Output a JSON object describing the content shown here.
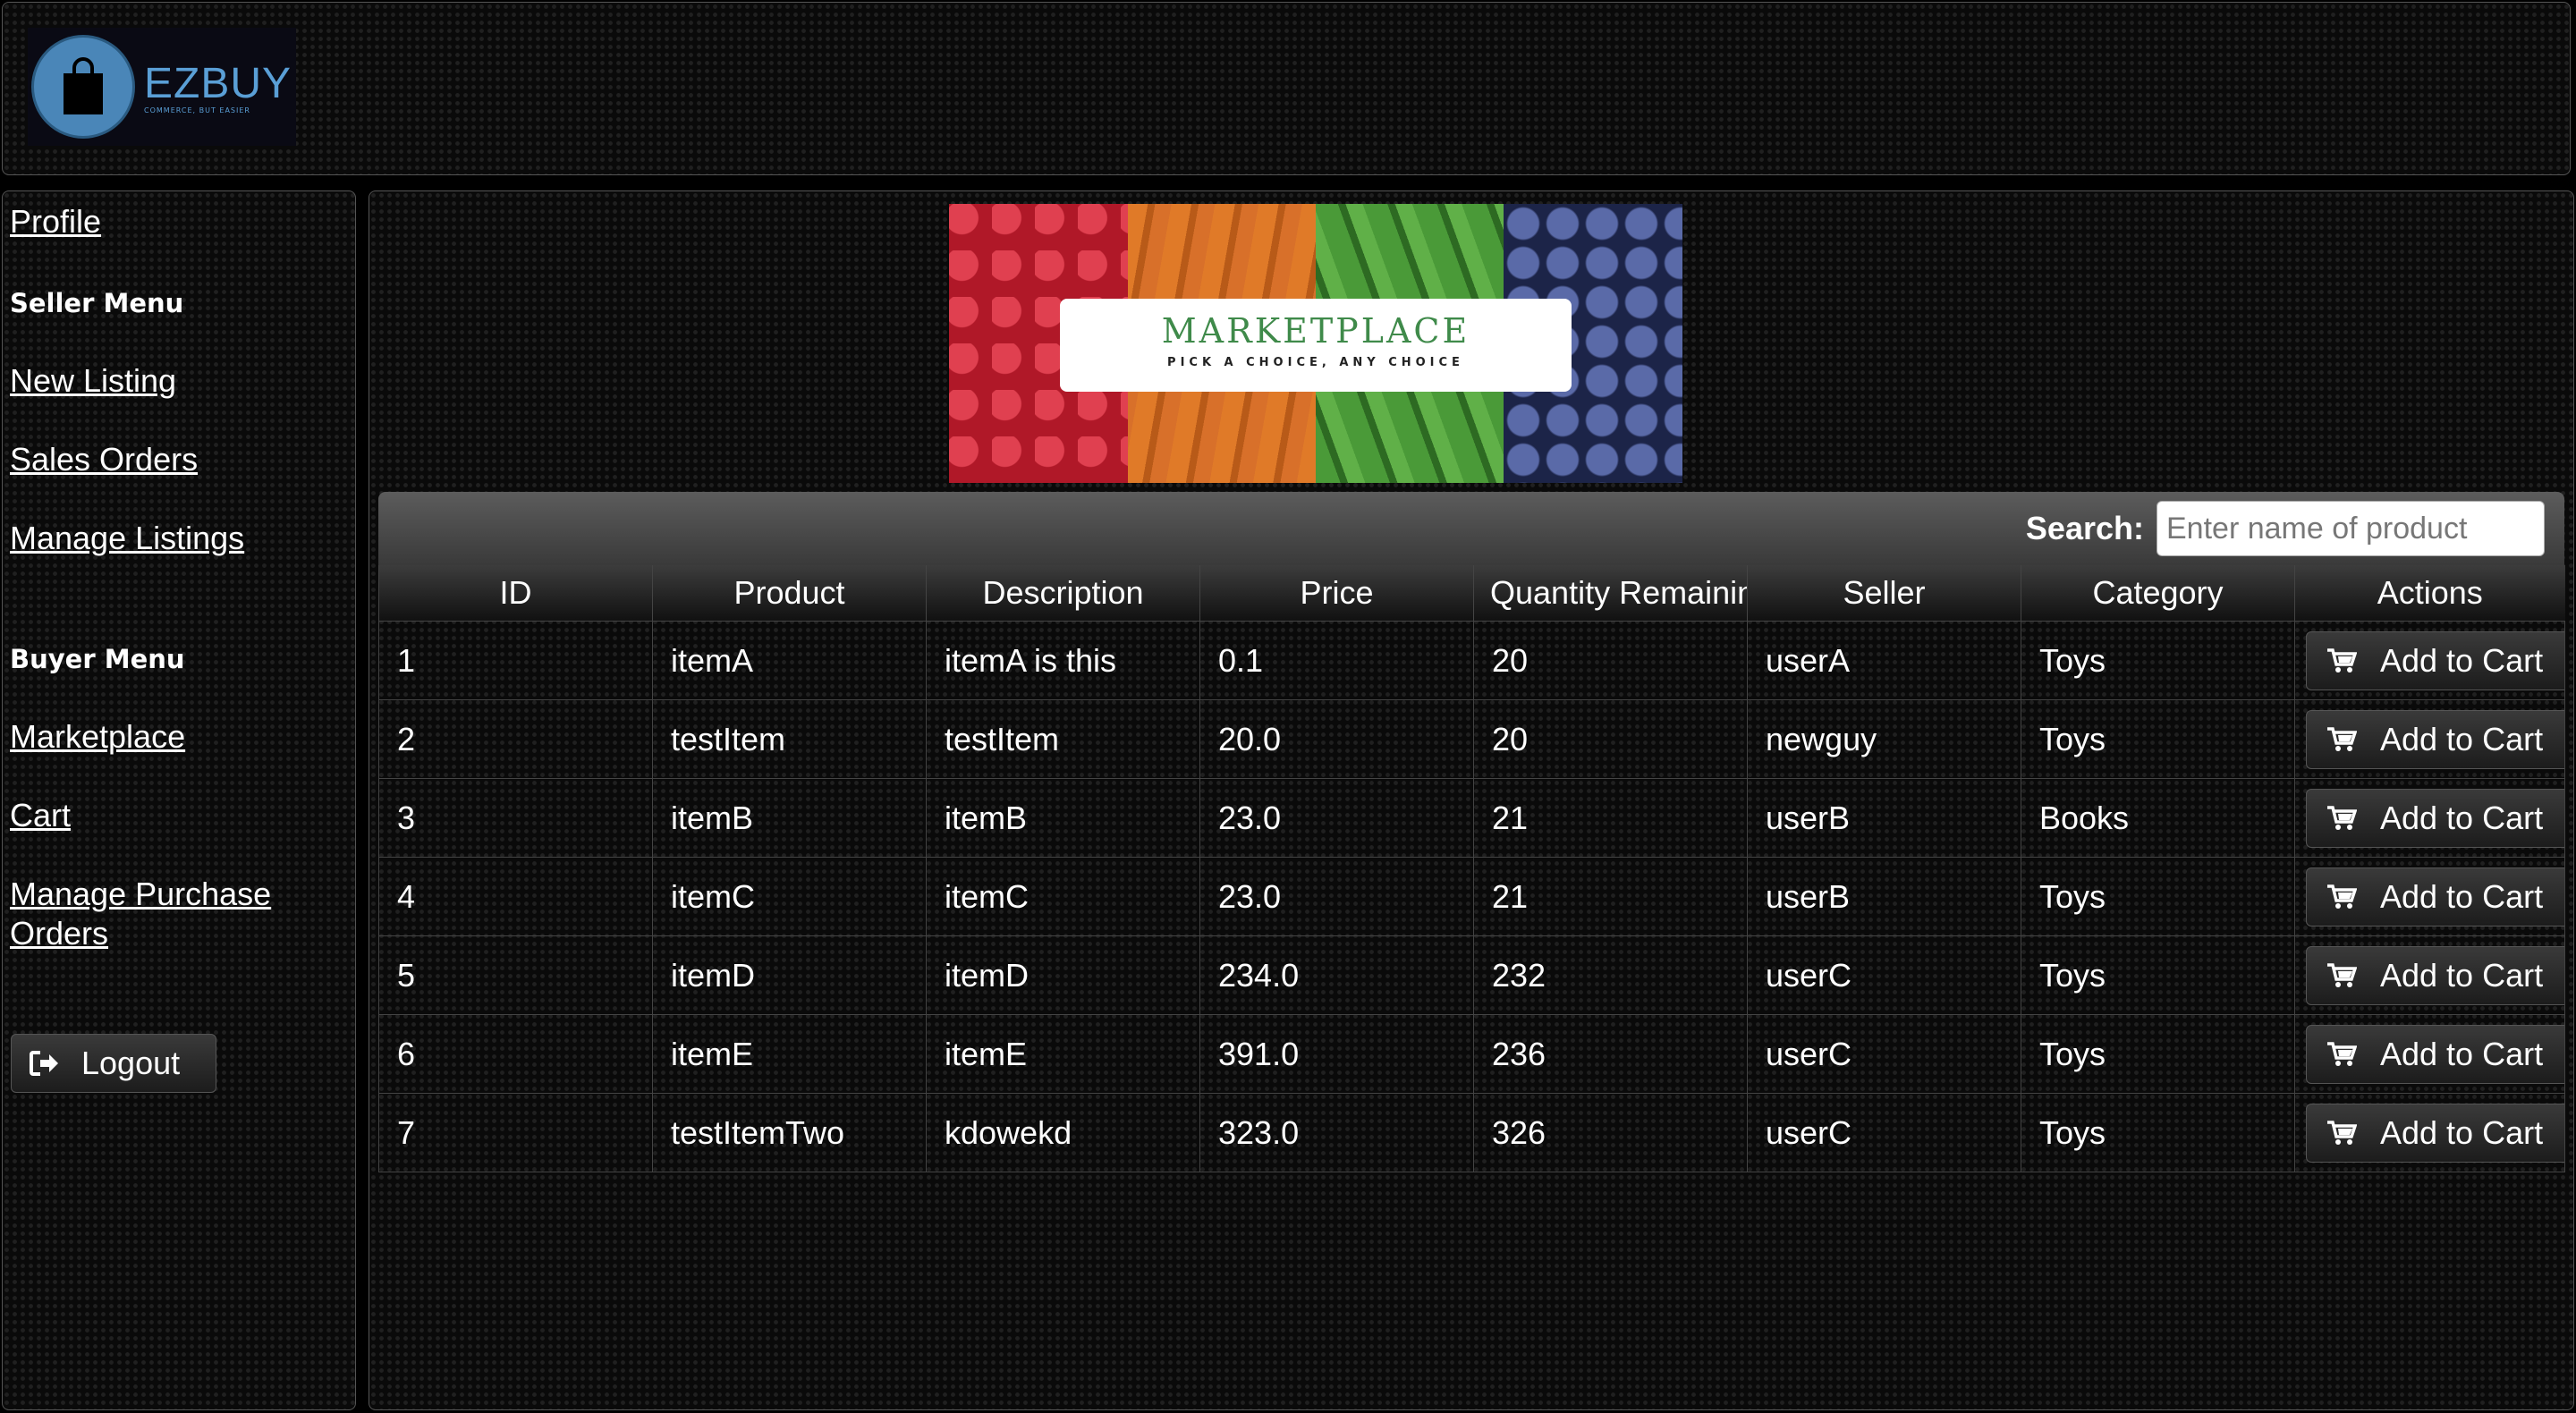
{
  "header": {
    "logo_name": "EZBUY",
    "logo_tagline": "COMMERCE, BUT EASIER"
  },
  "sidebar": {
    "profile": "Profile",
    "seller_menu": {
      "heading": "Seller Menu",
      "items": [
        "New Listing",
        "Sales Orders",
        "Manage Listings"
      ]
    },
    "buyer_menu": {
      "heading": "Buyer Menu",
      "items": [
        "Marketplace",
        "Cart",
        "Manage Purchase Orders"
      ]
    },
    "logout_label": "Logout"
  },
  "banner": {
    "title": "MARKETPLACE",
    "subtitle": "PICK A CHOICE, ANY CHOICE"
  },
  "search": {
    "label": "Search:",
    "placeholder": "Enter name of product"
  },
  "table": {
    "columns": [
      "ID",
      "Product",
      "Description",
      "Price",
      "Quantity Remaining",
      "Seller",
      "Category",
      "Actions"
    ],
    "action_label": "Add to Cart",
    "rows": [
      [
        "1",
        "itemA",
        "itemA is this",
        "0.1",
        "20",
        "userA",
        "Toys"
      ],
      [
        "2",
        "testItem",
        "testItem",
        "20.0",
        "20",
        "newguy",
        "Toys"
      ],
      [
        "3",
        "itemB",
        "itemB",
        "23.0",
        "21",
        "userB",
        "Books"
      ],
      [
        "4",
        "itemC",
        "itemC",
        "23.0",
        "21",
        "userB",
        "Toys"
      ],
      [
        "5",
        "itemD",
        "itemD",
        "234.0",
        "232",
        "userC",
        "Toys"
      ],
      [
        "6",
        "itemE",
        "itemE",
        "391.0",
        "236",
        "userC",
        "Toys"
      ],
      [
        "7",
        "testItemTwo",
        "kdowekd",
        "323.0",
        "326",
        "userC",
        "Toys"
      ]
    ]
  },
  "colors": {
    "logo_blue": "#4a86b8",
    "banner_green": "#3f8a4a",
    "background": "#0a0a0a"
  },
  "icons": {
    "cart": "cart-icon",
    "logout": "sign-out-icon",
    "logo": "shopping-bag-icon"
  }
}
